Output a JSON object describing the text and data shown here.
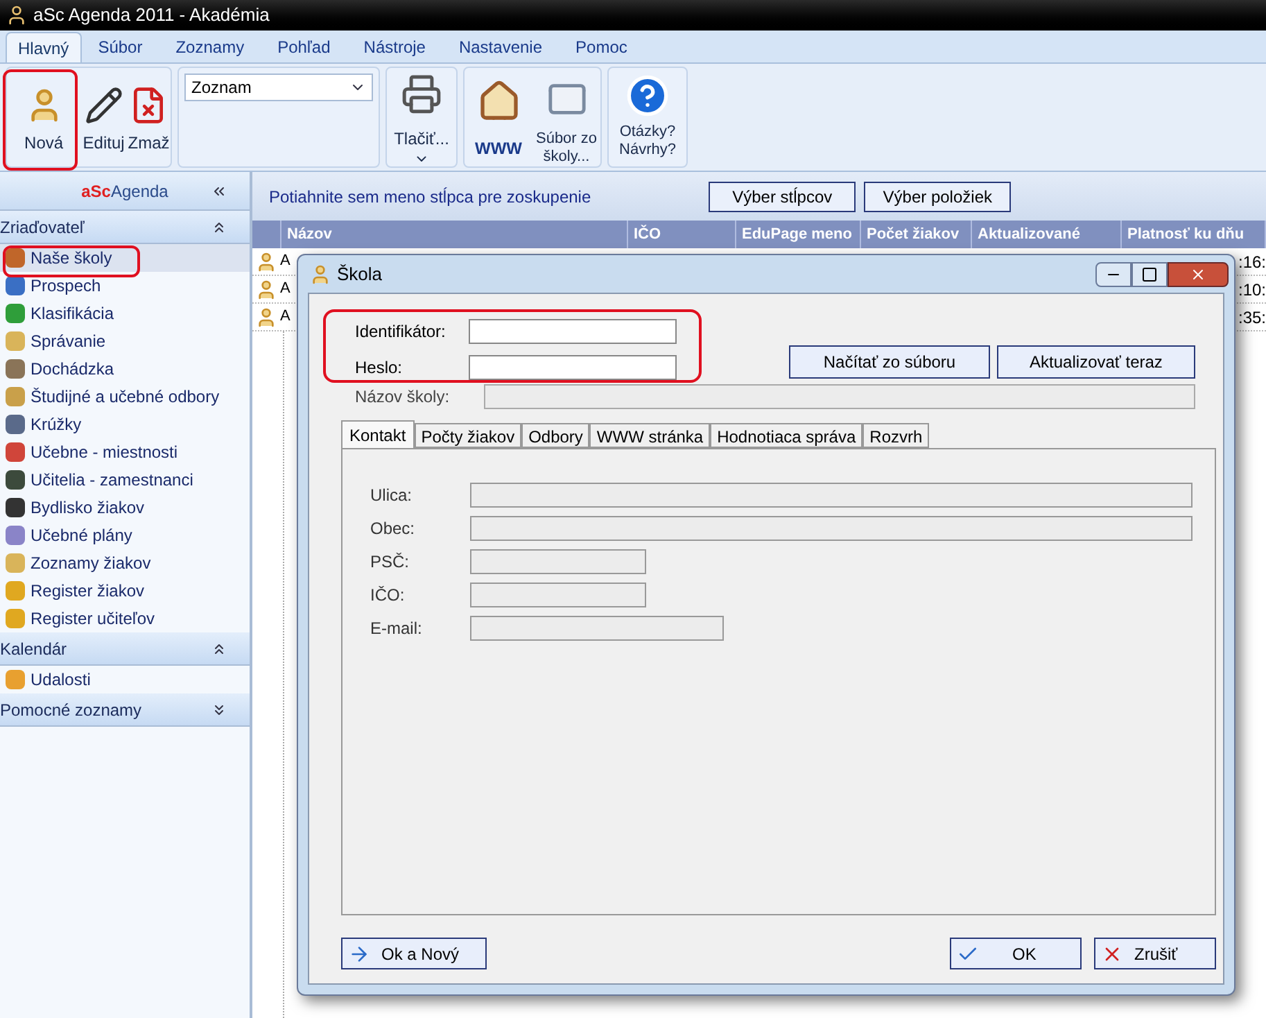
{
  "window": {
    "title": "aSc Agenda 2011 - Akadémia"
  },
  "menu_tabs": [
    {
      "label": "Hlavný",
      "selected": true
    },
    {
      "label": "Súbor",
      "selected": false
    },
    {
      "label": "Zoznamy",
      "selected": false
    },
    {
      "label": "Pohľad",
      "selected": false
    },
    {
      "label": "Nástroje",
      "selected": false
    },
    {
      "label": "Nastavenie",
      "selected": false
    },
    {
      "label": "Pomoc",
      "selected": false
    }
  ],
  "ribbon": {
    "edit_buttons": [
      {
        "label": "Nová",
        "kind": "person"
      },
      {
        "label": "Edituj",
        "kind": "edit"
      },
      {
        "label": "Zmaž",
        "kind": "delete"
      }
    ],
    "view_select": {
      "value": "Zoznam"
    },
    "print_button": {
      "label": "Tlačiť..."
    },
    "web_buttons": [
      {
        "label": "WWW",
        "kind": "www"
      },
      {
        "label": "Súbor zo školy...",
        "kind": "mail"
      }
    ],
    "help_button": {
      "label": "Otázky? Návrhy?"
    }
  },
  "sidebar": {
    "brand_accent": "aSc",
    "brand_rest": "Agenda",
    "groups": [
      {
        "title": "Zriaďovateľ",
        "expanded": true,
        "items": [
          {
            "label": "Naše školy",
            "selected": true,
            "color": "#c0662a"
          },
          {
            "label": "Prospech",
            "selected": false,
            "color": "#3a6fc4"
          },
          {
            "label": "Klasifikácia",
            "selected": false,
            "color": "#2f9e3a"
          },
          {
            "label": "Správanie",
            "selected": false,
            "color": "#d9b45a"
          },
          {
            "label": "Dochádzka",
            "selected": false,
            "color": "#8a7458"
          },
          {
            "label": "Študijné a učebné odbory",
            "selected": false,
            "color": "#c9a04a"
          },
          {
            "label": "Krúžky",
            "selected": false,
            "color": "#5a6a8a"
          },
          {
            "label": "Učebne - miestnosti",
            "selected": false,
            "color": "#d0453a"
          },
          {
            "label": "Učitelia - zamestnanci",
            "selected": false,
            "color": "#3c4a3c"
          },
          {
            "label": "Bydlisko žiakov",
            "selected": false,
            "color": "#333333"
          },
          {
            "label": "Učebné plány",
            "selected": false,
            "color": "#8a84c8"
          },
          {
            "label": "Zoznamy žiakov",
            "selected": false,
            "color": "#d9b45a"
          },
          {
            "label": "Register žiakov",
            "selected": false,
            "color": "#e0a820"
          },
          {
            "label": "Register učiteľov",
            "selected": false,
            "color": "#e0a820"
          }
        ]
      },
      {
        "title": "Kalendár",
        "expanded": true,
        "items": [
          {
            "label": "Udalosti",
            "selected": false,
            "color": "#e8a030"
          }
        ]
      },
      {
        "title": "Pomocné zoznamy",
        "expanded": false
      }
    ]
  },
  "grid": {
    "group_hint": "Potiahnite sem meno stĺpca pre zoskupenie",
    "buttons": [
      "Výber stĺpcov",
      "Výber položiek"
    ],
    "columns": [
      "Názov",
      "IČO",
      "EduPage meno",
      "Počet žiakov",
      "Aktualizované",
      "Platnosť ku dňu"
    ],
    "rows": [
      {
        "name": "A",
        "validity": ":16:"
      },
      {
        "name": "A",
        "validity": ":10:"
      },
      {
        "name": "A",
        "validity": ":35:"
      }
    ]
  },
  "dialog": {
    "title": "Škola",
    "identifier": {
      "label": "Identifikátor:"
    },
    "password": {
      "label": "Heslo:"
    },
    "school_name": {
      "label": "Názov školy:"
    },
    "actions": [
      "Načítať zo súboru",
      "Aktualizovať teraz"
    ],
    "tabs": [
      {
        "label": "Kontakt",
        "selected": true
      },
      {
        "label": "Počty žiakov",
        "selected": false
      },
      {
        "label": "Odbory",
        "selected": false
      },
      {
        "label": "WWW stránka",
        "selected": false
      },
      {
        "label": "Hodnotiaca správa",
        "selected": false
      },
      {
        "label": "Rozvrh",
        "selected": false
      }
    ],
    "contact_fields": [
      {
        "label": "Ulica:",
        "kind": "long"
      },
      {
        "label": "Obec:",
        "kind": "long"
      },
      {
        "label": "PSČ:",
        "kind": "short"
      },
      {
        "label": "IČO:",
        "kind": "short"
      },
      {
        "label": "E-mail:",
        "kind": "medium"
      }
    ],
    "footer_buttons": [
      {
        "label": "Ok a Nový",
        "kind": "ok_new"
      },
      {
        "label": "OK",
        "kind": "ok"
      },
      {
        "label": "Zrušiť",
        "kind": "cancel"
      }
    ]
  }
}
